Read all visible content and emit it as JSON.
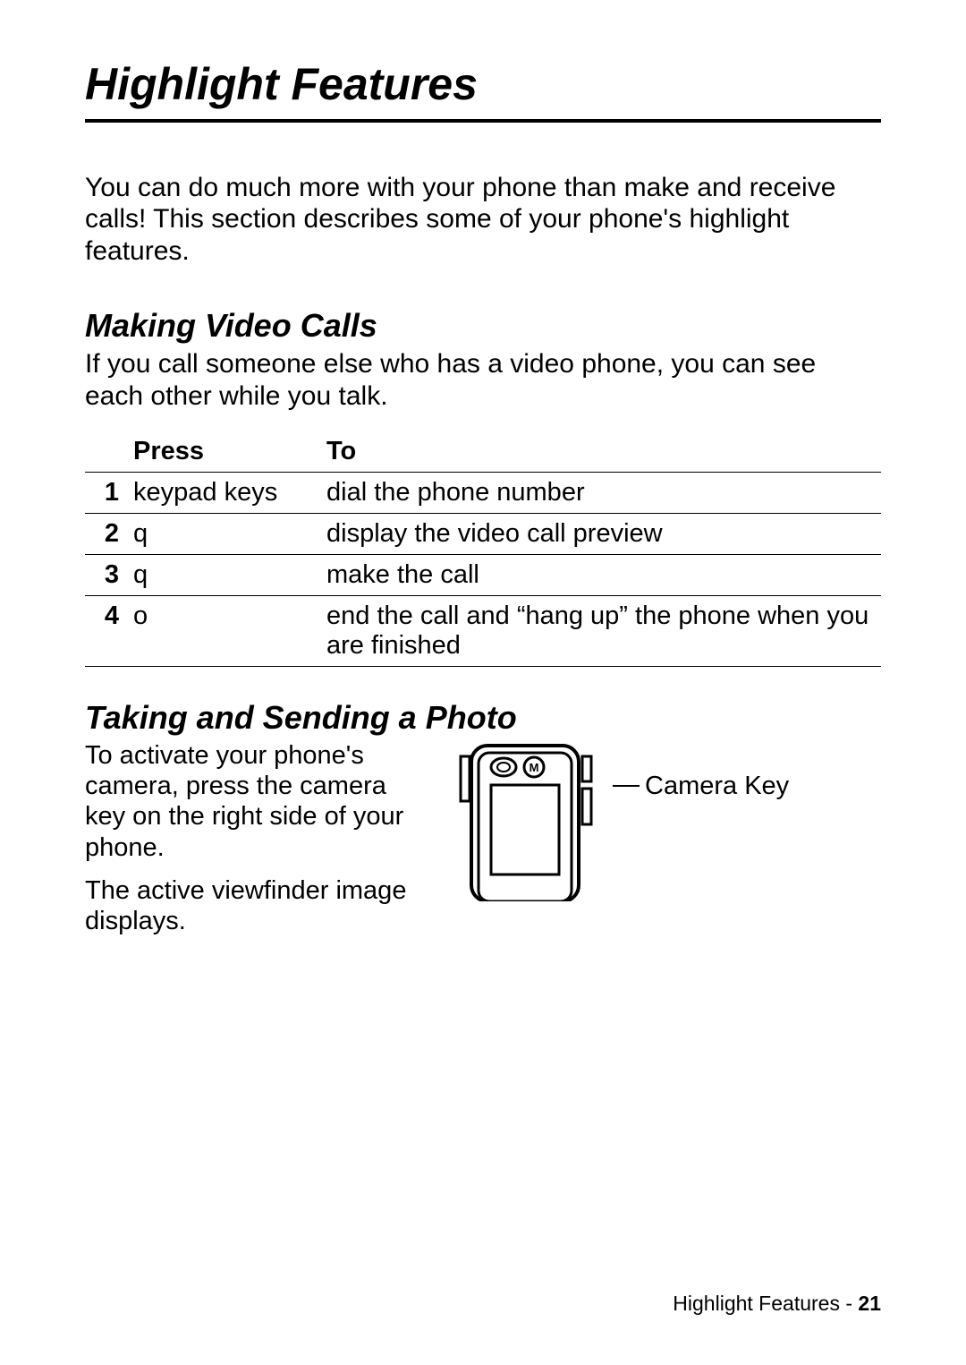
{
  "title": "Highlight Features",
  "intro": "You can do much more with your phone than make and receive calls! This section describes some of your phone's highlight features.",
  "section1": {
    "heading": "Making Video Calls",
    "intro": "If you call someone else who has a video phone, you can see each other while you talk.",
    "headers": {
      "press": "Press",
      "to": "To"
    },
    "rows": [
      {
        "n": "1",
        "press": "keypad keys",
        "to": "dial the phone number"
      },
      {
        "n": "2",
        "press": "q",
        "to": "display the video call preview"
      },
      {
        "n": "3",
        "press": "q",
        "to": "make the call"
      },
      {
        "n": "4",
        "press": "o",
        "to": "end the call and “hang up” the phone when you are finished"
      }
    ]
  },
  "section2": {
    "heading": "Taking and Sending a Photo",
    "para1": "To activate your phone's camera, press the camera key on the right side of your phone.",
    "para2": "The active viewfinder image displays.",
    "callout": "Camera Key"
  },
  "footer": {
    "section": "Highlight Features",
    "sep": " - ",
    "page": "21"
  }
}
